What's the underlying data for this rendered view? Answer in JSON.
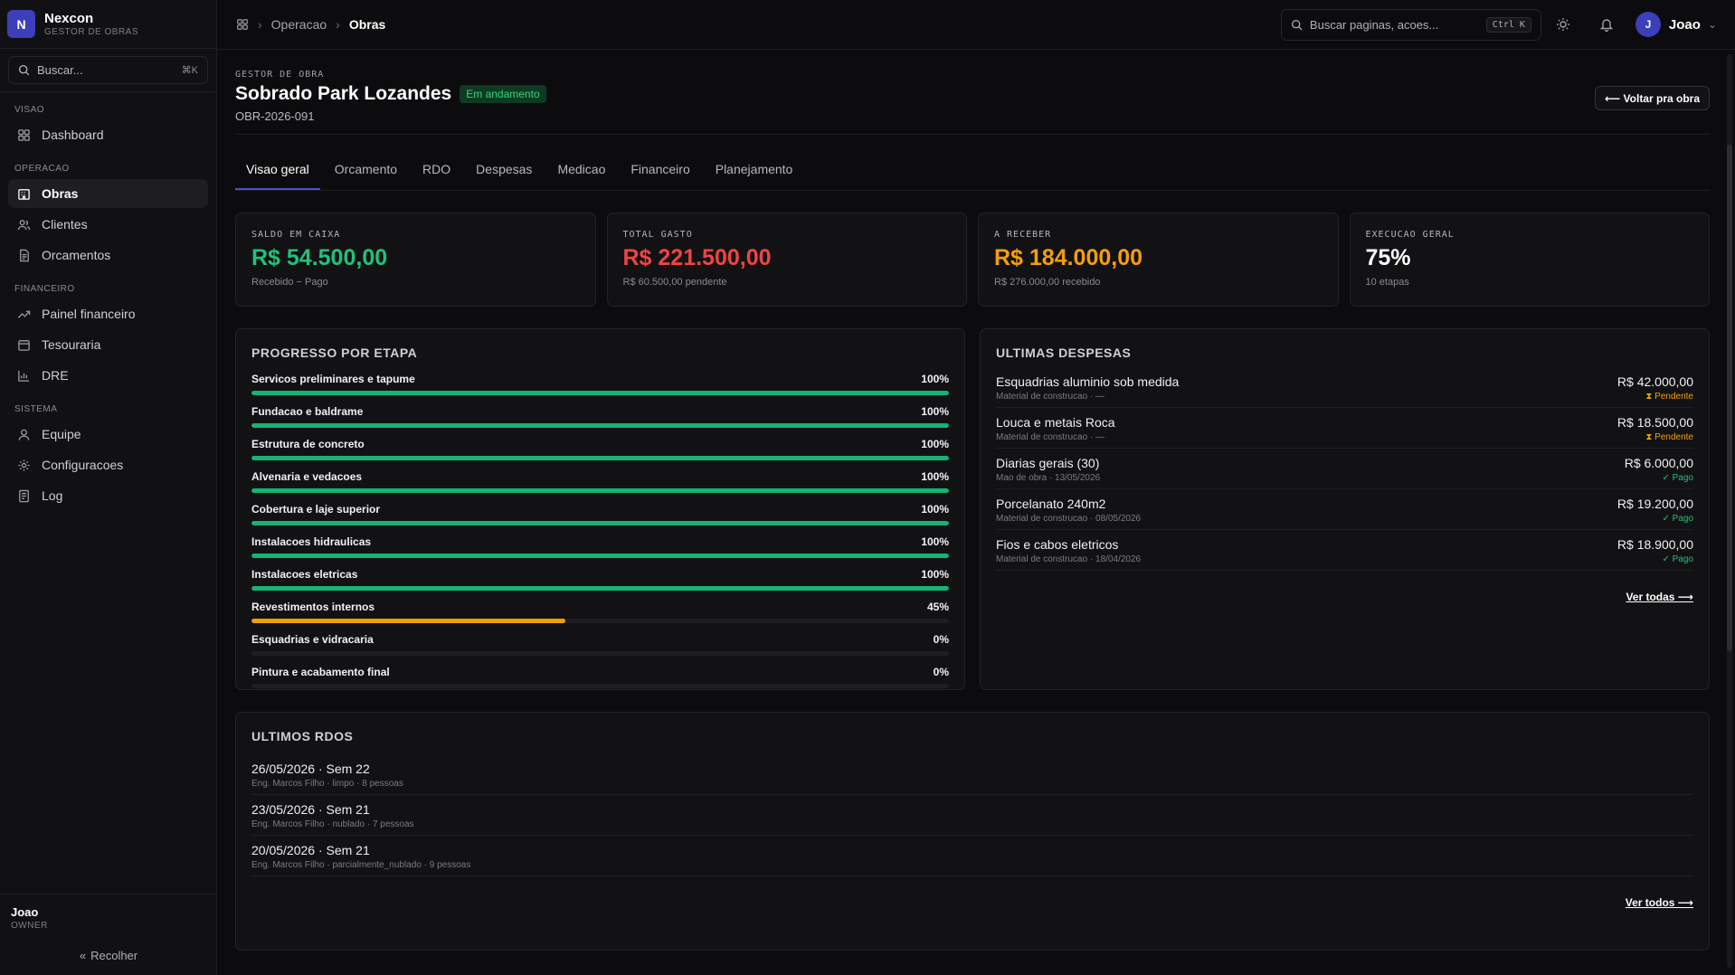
{
  "brand": {
    "initial": "N",
    "name": "Nexcon",
    "subtitle": "GESTOR DE OBRAS"
  },
  "sidebar": {
    "search_placeholder": "Buscar...",
    "search_shortcut": "⌘K",
    "sections": [
      {
        "label": "VISAO",
        "items": [
          {
            "label": "Dashboard",
            "icon": "dashboard-icon"
          }
        ]
      },
      {
        "label": "OPERACAO",
        "items": [
          {
            "label": "Obras",
            "icon": "building-icon",
            "active": true
          },
          {
            "label": "Clientes",
            "icon": "users-icon"
          },
          {
            "label": "Orcamentos",
            "icon": "document-icon"
          }
        ]
      },
      {
        "label": "FINANCEIRO",
        "items": [
          {
            "label": "Painel financeiro",
            "icon": "trend-icon"
          },
          {
            "label": "Tesouraria",
            "icon": "wallet-icon"
          },
          {
            "label": "DRE",
            "icon": "bar-chart-icon"
          }
        ]
      },
      {
        "label": "SISTEMA",
        "items": [
          {
            "label": "Equipe",
            "icon": "user-icon"
          },
          {
            "label": "Configuracoes",
            "icon": "gear-icon"
          },
          {
            "label": "Log",
            "icon": "log-icon"
          }
        ]
      }
    ],
    "user_name": "Joao",
    "user_role": "OWNER",
    "collapse_label": "Recolher"
  },
  "topbar": {
    "breadcrumb": [
      "Operacao",
      "Obras"
    ],
    "search_placeholder": "Buscar paginas, acoes...",
    "search_shortcut": "Ctrl K",
    "user_initial": "J",
    "user_name": "Joao"
  },
  "header": {
    "eyebrow": "GESTOR DE OBRA",
    "title": "Sobrado Park Lozandes",
    "status": "Em andamento",
    "code": "OBR-2026-091",
    "back_label": "⟵ Voltar pra obra"
  },
  "tabs": [
    "Visao geral",
    "Orcamento",
    "RDO",
    "Despesas",
    "Medicao",
    "Financeiro",
    "Planejamento"
  ],
  "kpis": [
    {
      "label": "SALDO EM CAIXA",
      "value": "R$ 54.500,00",
      "sub": "Recebido − Pago",
      "color": "#22c07a"
    },
    {
      "label": "TOTAL GASTO",
      "value": "R$ 221.500,00",
      "sub": "R$ 60.500,00 pendente",
      "color": "#ef4444"
    },
    {
      "label": "A RECEBER",
      "value": "R$ 184.000,00",
      "sub": "R$ 276.000,00 recebido",
      "color": "#f59e0b"
    },
    {
      "label": "EXECUCAO GERAL",
      "value": "75%",
      "sub": "10 etapas",
      "color": "#ffffff"
    }
  ],
  "progress": {
    "title": "PROGRESSO POR ETAPA",
    "stages": [
      {
        "name": "Servicos preliminares e tapume",
        "pct_label": "100%",
        "pct": 100
      },
      {
        "name": "Fundacao e baldrame",
        "pct_label": "100%",
        "pct": 100
      },
      {
        "name": "Estrutura de concreto",
        "pct_label": "100%",
        "pct": 100
      },
      {
        "name": "Alvenaria e vedacoes",
        "pct_label": "100%",
        "pct": 100
      },
      {
        "name": "Cobertura e laje superior",
        "pct_label": "100%",
        "pct": 100
      },
      {
        "name": "Instalacoes hidraulicas",
        "pct_label": "100%",
        "pct": 100
      },
      {
        "name": "Instalacoes eletricas",
        "pct_label": "100%",
        "pct": 100
      },
      {
        "name": "Revestimentos internos",
        "pct_label": "45%",
        "pct": 45
      },
      {
        "name": "Esquadrias e vidracaria",
        "pct_label": "0%",
        "pct": 0
      },
      {
        "name": "Pintura e acabamento final",
        "pct_label": "0%",
        "pct": 0
      }
    ],
    "colors": {
      "done": "#16b374",
      "partial": "#f59e0b"
    }
  },
  "expenses": {
    "title": "ULTIMAS DESPESAS",
    "items": [
      {
        "name": "Esquadrias aluminio sob medida",
        "meta": "Material de construcao · —",
        "value": "R$ 42.000,00",
        "status": "⧗ Pendente",
        "status_color": "#f59e0b"
      },
      {
        "name": "Louca e metais Roca",
        "meta": "Material de construcao · —",
        "value": "R$ 18.500,00",
        "status": "⧗ Pendente",
        "status_color": "#f59e0b"
      },
      {
        "name": "Diarias gerais (30)",
        "meta": "Mao de obra · 13/05/2026",
        "value": "R$ 6.000,00",
        "status": "✓ Pago",
        "status_color": "#22c07a"
      },
      {
        "name": "Porcelanato 240m2",
        "meta": "Material de construcao · 08/05/2026",
        "value": "R$ 19.200,00",
        "status": "✓ Pago",
        "status_color": "#22c07a"
      },
      {
        "name": "Fios e cabos eletricos",
        "meta": "Material de construcao · 18/04/2026",
        "value": "R$ 18.900,00",
        "status": "✓ Pago",
        "status_color": "#22c07a"
      }
    ],
    "see_all": "Ver todas ⟶"
  },
  "rdos": {
    "title": "ULTIMOS RDOS",
    "items": [
      {
        "title": "26/05/2026 · Sem 22",
        "meta": "Eng. Marcos Filho · limpo · 8 pessoas"
      },
      {
        "title": "23/05/2026 · Sem 21",
        "meta": "Eng. Marcos Filho · nublado · 7 pessoas"
      },
      {
        "title": "20/05/2026 · Sem 21",
        "meta": "Eng. Marcos Filho · parcialmente_nublado · 9 pessoas"
      }
    ],
    "see_all": "Ver todos ⟶"
  }
}
